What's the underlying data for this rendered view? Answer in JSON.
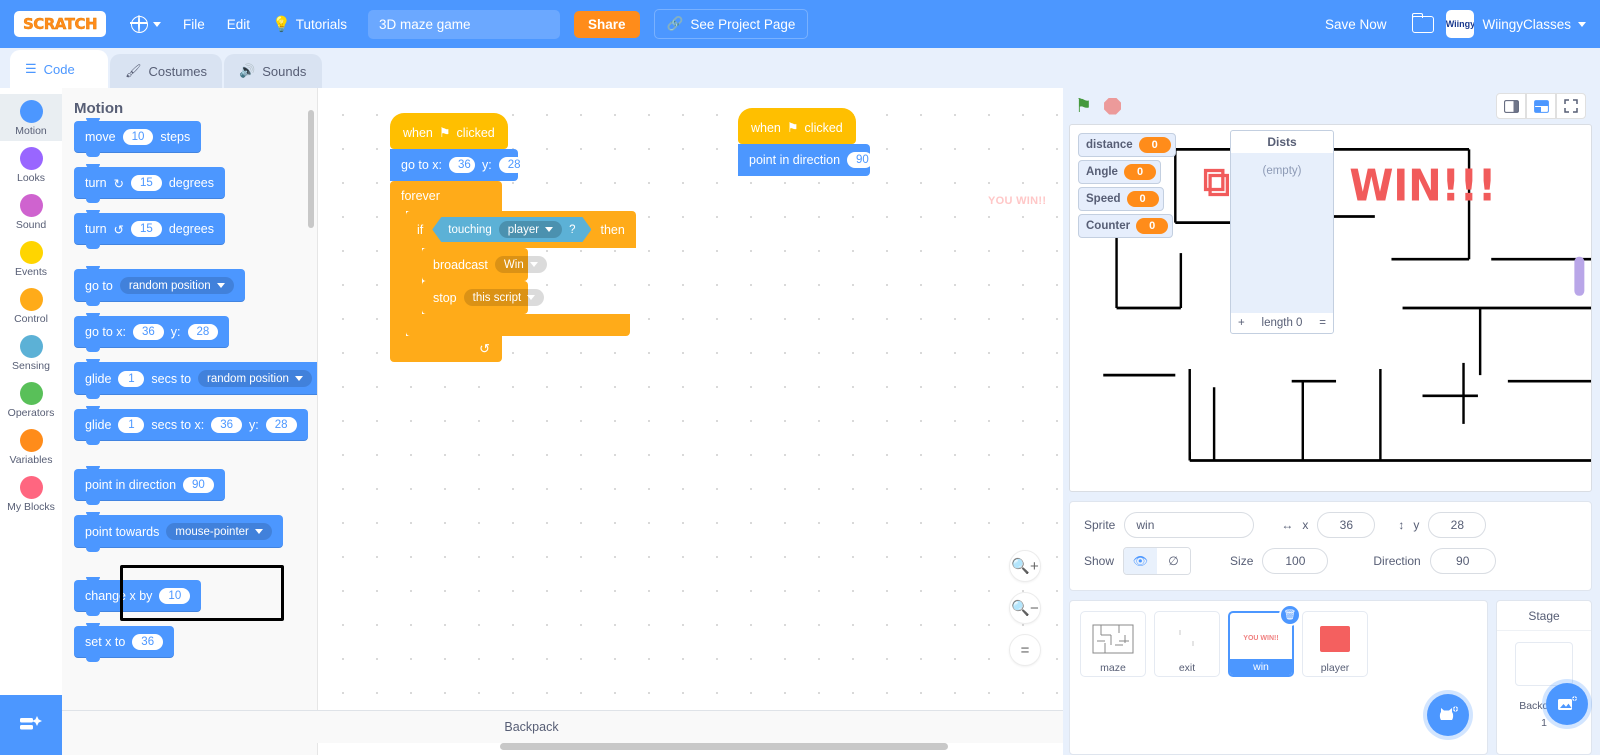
{
  "menubar": {
    "logo_text": "SCRATCH",
    "globe_icon": "globe-icon",
    "file_label": "File",
    "edit_label": "Edit",
    "tutorials_icon": "lightbulb-icon",
    "tutorials_label": "Tutorials",
    "project_title_value": "3D maze game",
    "project_title_placeholder": "Project title",
    "share_label": "Share",
    "see_project_icon": "share-nodes-icon",
    "see_project_label": "See Project Page",
    "save_now_label": "Save Now",
    "folder_icon": "folder-icon",
    "avatar_initials": "Wiingy",
    "user_name": "WiingyClasses"
  },
  "tabs": [
    {
      "label": "Code",
      "icon": "code-blocks-icon",
      "active": true
    },
    {
      "label": "Costumes",
      "icon": "paintbrush-icon",
      "active": false
    },
    {
      "label": "Sounds",
      "icon": "speaker-icon",
      "active": false
    }
  ],
  "categories": [
    {
      "label": "Motion",
      "color": "#4c97ff",
      "selected": true
    },
    {
      "label": "Looks",
      "color": "#9966ff",
      "selected": false
    },
    {
      "label": "Sound",
      "color": "#cf63cf",
      "selected": false
    },
    {
      "label": "Events",
      "color": "#ffd500",
      "selected": false
    },
    {
      "label": "Control",
      "color": "#ffab19",
      "selected": false
    },
    {
      "label": "Sensing",
      "color": "#5cb1d6",
      "selected": false
    },
    {
      "label": "Operators",
      "color": "#59c059",
      "selected": false
    },
    {
      "label": "Variables",
      "color": "#ff8c1a",
      "selected": false
    },
    {
      "label": "My Blocks",
      "color": "#ff6680",
      "selected": false
    }
  ],
  "add_extension_icon": "add-extension-icon",
  "palette": {
    "header": "Motion",
    "blocks": [
      {
        "id": "move",
        "parts": [
          {
            "t": "text",
            "v": "move"
          },
          {
            "t": "oval",
            "v": "10"
          },
          {
            "t": "text",
            "v": "steps"
          }
        ]
      },
      {
        "id": "turn-right",
        "parts": [
          {
            "t": "text",
            "v": "turn"
          },
          {
            "t": "icon",
            "v": "↻"
          },
          {
            "t": "oval",
            "v": "15"
          },
          {
            "t": "text",
            "v": "degrees"
          }
        ]
      },
      {
        "id": "turn-left",
        "parts": [
          {
            "t": "text",
            "v": "turn"
          },
          {
            "t": "icon",
            "v": "↺"
          },
          {
            "t": "oval",
            "v": "15"
          },
          {
            "t": "text",
            "v": "degrees"
          }
        ]
      },
      {
        "id": "go-to",
        "parts": [
          {
            "t": "text",
            "v": "go to"
          },
          {
            "t": "drop",
            "v": "random position"
          }
        ]
      },
      {
        "id": "go-to-xy",
        "parts": [
          {
            "t": "text",
            "v": "go to x:"
          },
          {
            "t": "oval",
            "v": "36"
          },
          {
            "t": "text",
            "v": "y:"
          },
          {
            "t": "oval",
            "v": "28"
          }
        ]
      },
      {
        "id": "glide-to",
        "parts": [
          {
            "t": "text",
            "v": "glide"
          },
          {
            "t": "oval",
            "v": "1"
          },
          {
            "t": "text",
            "v": "secs to"
          },
          {
            "t": "drop",
            "v": "random position"
          }
        ]
      },
      {
        "id": "glide-to-xy",
        "parts": [
          {
            "t": "text",
            "v": "glide"
          },
          {
            "t": "oval",
            "v": "1"
          },
          {
            "t": "text",
            "v": "secs to x:"
          },
          {
            "t": "oval",
            "v": "36"
          },
          {
            "t": "text",
            "v": "y:"
          },
          {
            "t": "oval",
            "v": "28"
          }
        ]
      },
      {
        "id": "point-in-direction",
        "highlighted": true,
        "parts": [
          {
            "t": "text",
            "v": "point in direction"
          },
          {
            "t": "oval",
            "v": "90"
          }
        ]
      },
      {
        "id": "point-towards",
        "parts": [
          {
            "t": "text",
            "v": "point towards"
          },
          {
            "t": "drop",
            "v": "mouse-pointer"
          }
        ]
      },
      {
        "id": "change-x-by",
        "parts": [
          {
            "t": "text",
            "v": "change x by"
          },
          {
            "t": "oval",
            "v": "10"
          }
        ]
      },
      {
        "id": "set-x-to",
        "parts": [
          {
            "t": "text",
            "v": "set x to"
          },
          {
            "t": "oval",
            "v": "36"
          }
        ]
      }
    ]
  },
  "canvas": {
    "watermark": "YOU WIN!!",
    "script1": {
      "hat": {
        "pre": "when",
        "icon": "green-flag-icon",
        "post": "clicked"
      },
      "goto": {
        "label_x": "go to x:",
        "x": "36",
        "label_y": "y:",
        "y": "28"
      },
      "forever": "forever",
      "if_label": "if",
      "then_label": "then",
      "touching_label": "touching",
      "touching_target": "player",
      "question": "?",
      "broadcast_label": "broadcast",
      "broadcast_msg": "Win",
      "stop_label": "stop",
      "stop_target": "this script",
      "loop_arrow": "↺"
    },
    "script2": {
      "hat": {
        "pre": "when",
        "icon": "green-flag-icon",
        "post": "clicked"
      },
      "point_label": "point in direction",
      "point_value": "90"
    },
    "zoom_in_icon": "zoom-in-icon",
    "zoom_out_icon": "zoom-out-icon",
    "zoom_reset_icon": "zoom-reset-icon"
  },
  "stage": {
    "green_flag_icon": "green-flag-icon",
    "stop_icon": "stop-sign-icon",
    "mode_small_icon": "small-stage-icon",
    "mode_large_icon": "large-stage-icon",
    "mode_full_icon": "fullscreen-icon",
    "monitors": [
      {
        "name": "distance",
        "value": "0"
      },
      {
        "name": "Angle",
        "value": "0"
      },
      {
        "name": "Speed",
        "value": "0"
      },
      {
        "name": "Counter",
        "value": "0"
      }
    ],
    "list_monitor": {
      "name": "Dists",
      "empty_text": "(empty)",
      "add_label": "+",
      "length_label": "length 0",
      "resize_label": "="
    },
    "stage_win_text": "WIN!!!"
  },
  "sprite_info": {
    "sprite_label": "Sprite",
    "sprite_name": "win",
    "x_label": "x",
    "x_value": "36",
    "y_label": "y",
    "y_value": "28",
    "show_label": "Show",
    "show_on_icon": "eye-icon",
    "show_off_icon": "eye-slash-icon",
    "size_label": "Size",
    "size_value": "100",
    "direction_label": "Direction",
    "direction_value": "90"
  },
  "sprites": [
    {
      "name": "maze",
      "selected": false,
      "thumb": "maze-thumb"
    },
    {
      "name": "exit",
      "selected": false,
      "thumb": "exit-thumb"
    },
    {
      "name": "win",
      "selected": true,
      "thumb": "win-thumb",
      "thumb_text": "YOU WIN!!",
      "delete_badge": "trash-icon"
    },
    {
      "name": "player",
      "selected": false,
      "thumb": "player-thumb"
    }
  ],
  "stage_panel": {
    "title": "Stage",
    "backdrops_label": "Backdrops",
    "backdrops_count": "1"
  },
  "fabs": {
    "add_sprite_icon": "add-sprite-cat-icon",
    "add_backdrop_icon": "add-backdrop-image-icon"
  },
  "backpack": {
    "label": "Backpack"
  }
}
